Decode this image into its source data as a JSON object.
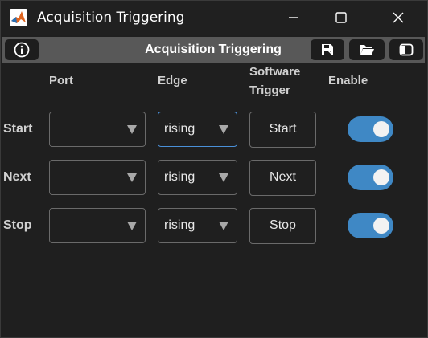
{
  "window": {
    "title": "Acquisition Triggering",
    "icon": "matlab-logo-icon"
  },
  "toolbar": {
    "title": "Acquisition Triggering",
    "buttons": [
      "info-icon",
      "save-icon",
      "folder-open-icon",
      "panel-toggle-icon"
    ]
  },
  "headers": {
    "port": "Port",
    "edge": "Edge",
    "software_trigger_line1": "Software",
    "software_trigger_line2": "Trigger",
    "enable": "Enable"
  },
  "rows": [
    {
      "label": "Start",
      "port": "",
      "edge": "rising",
      "trigger_button": "Start",
      "enabled": true
    },
    {
      "label": "Next",
      "port": "",
      "edge": "rising",
      "trigger_button": "Next",
      "enabled": true
    },
    {
      "label": "Stop",
      "port": "",
      "edge": "rising",
      "trigger_button": "Stop",
      "enabled": true
    }
  ],
  "colors": {
    "toggle_on": "#3f88c5",
    "focus_border": "#4a90d9",
    "toolbar_bg": "#585858"
  }
}
